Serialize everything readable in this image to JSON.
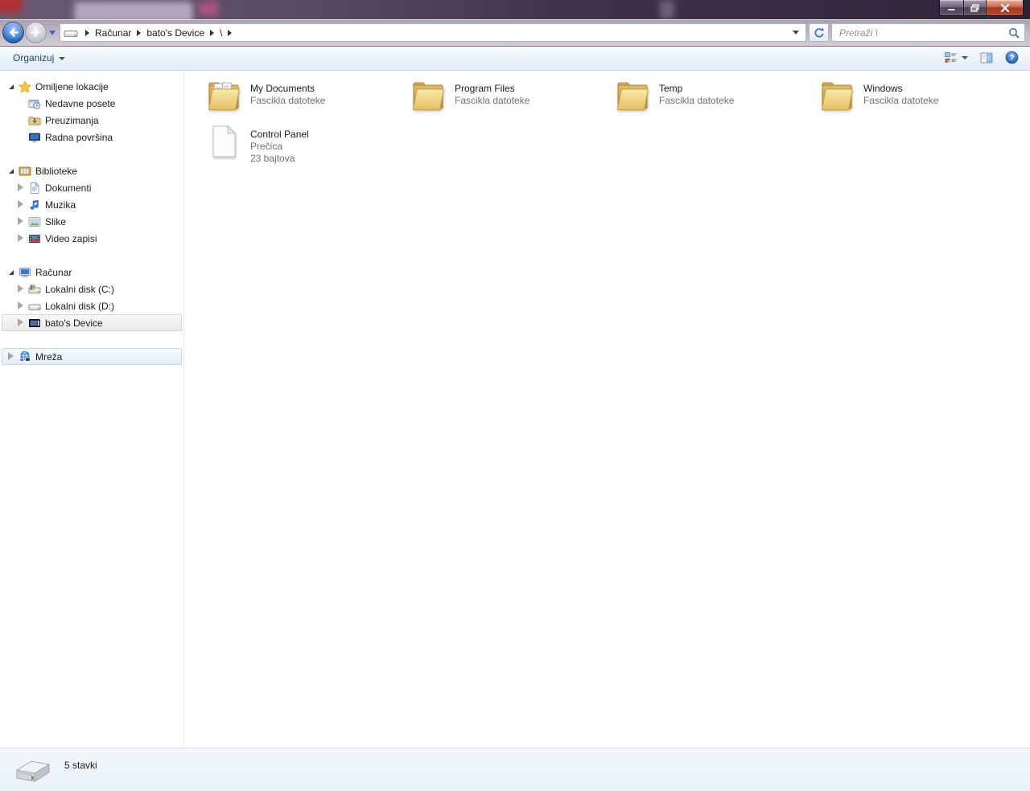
{
  "titlebar": {
    "buttons": {
      "minimize": "minimize",
      "restore": "restore",
      "close": "close"
    }
  },
  "address_bar": {
    "breadcrumb": {
      "root_icon": "device-icon",
      "items": [
        "Računar",
        "bato's Device",
        "\\"
      ]
    },
    "search_placeholder": "Pretraži \\"
  },
  "toolbar": {
    "organize": "Organizuj",
    "right_icons": [
      "views-icon",
      "preview-pane-icon",
      "help-icon"
    ]
  },
  "sidebar": {
    "sections": [
      {
        "label": "Omiljene lokacije",
        "icon": "star-icon",
        "expanded": true,
        "children": [
          {
            "label": "Nedavne posete",
            "icon": "recent-places-icon"
          },
          {
            "label": "Preuzimanja",
            "icon": "downloads-icon"
          },
          {
            "label": "Radna površina",
            "icon": "desktop-icon"
          }
        ]
      },
      {
        "label": "Biblioteke",
        "icon": "libraries-icon",
        "expanded": true,
        "children": [
          {
            "label": "Dokumenti",
            "icon": "document-icon"
          },
          {
            "label": "Muzika",
            "icon": "music-icon"
          },
          {
            "label": "Slike",
            "icon": "pictures-icon"
          },
          {
            "label": "Video zapisi",
            "icon": "video-icon"
          }
        ]
      },
      {
        "label": "Računar",
        "icon": "computer-icon",
        "expanded": true,
        "children": [
          {
            "label": "Lokalni disk (C:)",
            "icon": "disk-c-icon"
          },
          {
            "label": "Lokalni disk (D:)",
            "icon": "disk-d-icon"
          },
          {
            "label": "bato's Device",
            "icon": "portable-device-icon",
            "selected": true
          }
        ]
      },
      {
        "label": "Mreža",
        "icon": "network-icon",
        "expanded": false,
        "children": []
      }
    ]
  },
  "content": {
    "items": [
      {
        "name": "My Documents",
        "type": "Fascikla datoteke",
        "icon": "folder-with-documents-icon"
      },
      {
        "name": "Program Files",
        "type": "Fascikla datoteke",
        "icon": "folder-icon"
      },
      {
        "name": "Temp",
        "type": "Fascikla datoteke",
        "icon": "folder-icon"
      },
      {
        "name": "Windows",
        "type": "Fascikla datoteke",
        "icon": "folder-icon"
      },
      {
        "name": "Control Panel",
        "type": "Prečica",
        "size": "23 bajtova",
        "icon": "shortcut-file-icon"
      }
    ]
  },
  "statusbar": {
    "count": "5 stavki",
    "icon": "drive-icon"
  },
  "colors": {
    "close_button": "#b3492e",
    "toolbar_text": "#1e3c87",
    "selection_border": "#d5d5d5",
    "hover_border": "#bcd9f0"
  }
}
